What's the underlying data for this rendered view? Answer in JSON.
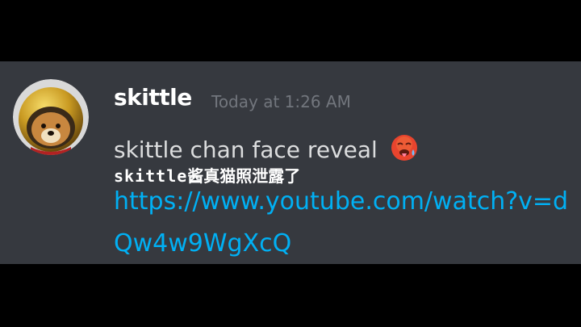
{
  "message": {
    "username": "skittle",
    "timestamp": "Today at 1:26 AM",
    "text_line": "skittle chan face reveal",
    "emoji": "hot-face-emoji",
    "subtitle_latin": "skittle",
    "subtitle_cjk": "酱真猫照泄露了",
    "link_url": "https://www.youtube.com/watch?v=dQw4w9WgXcQ",
    "colors": {
      "background": "#36393f",
      "username": "#ffffff",
      "timestamp": "#72767d",
      "body_text": "#dcddde",
      "link": "#00b0f4"
    }
  }
}
